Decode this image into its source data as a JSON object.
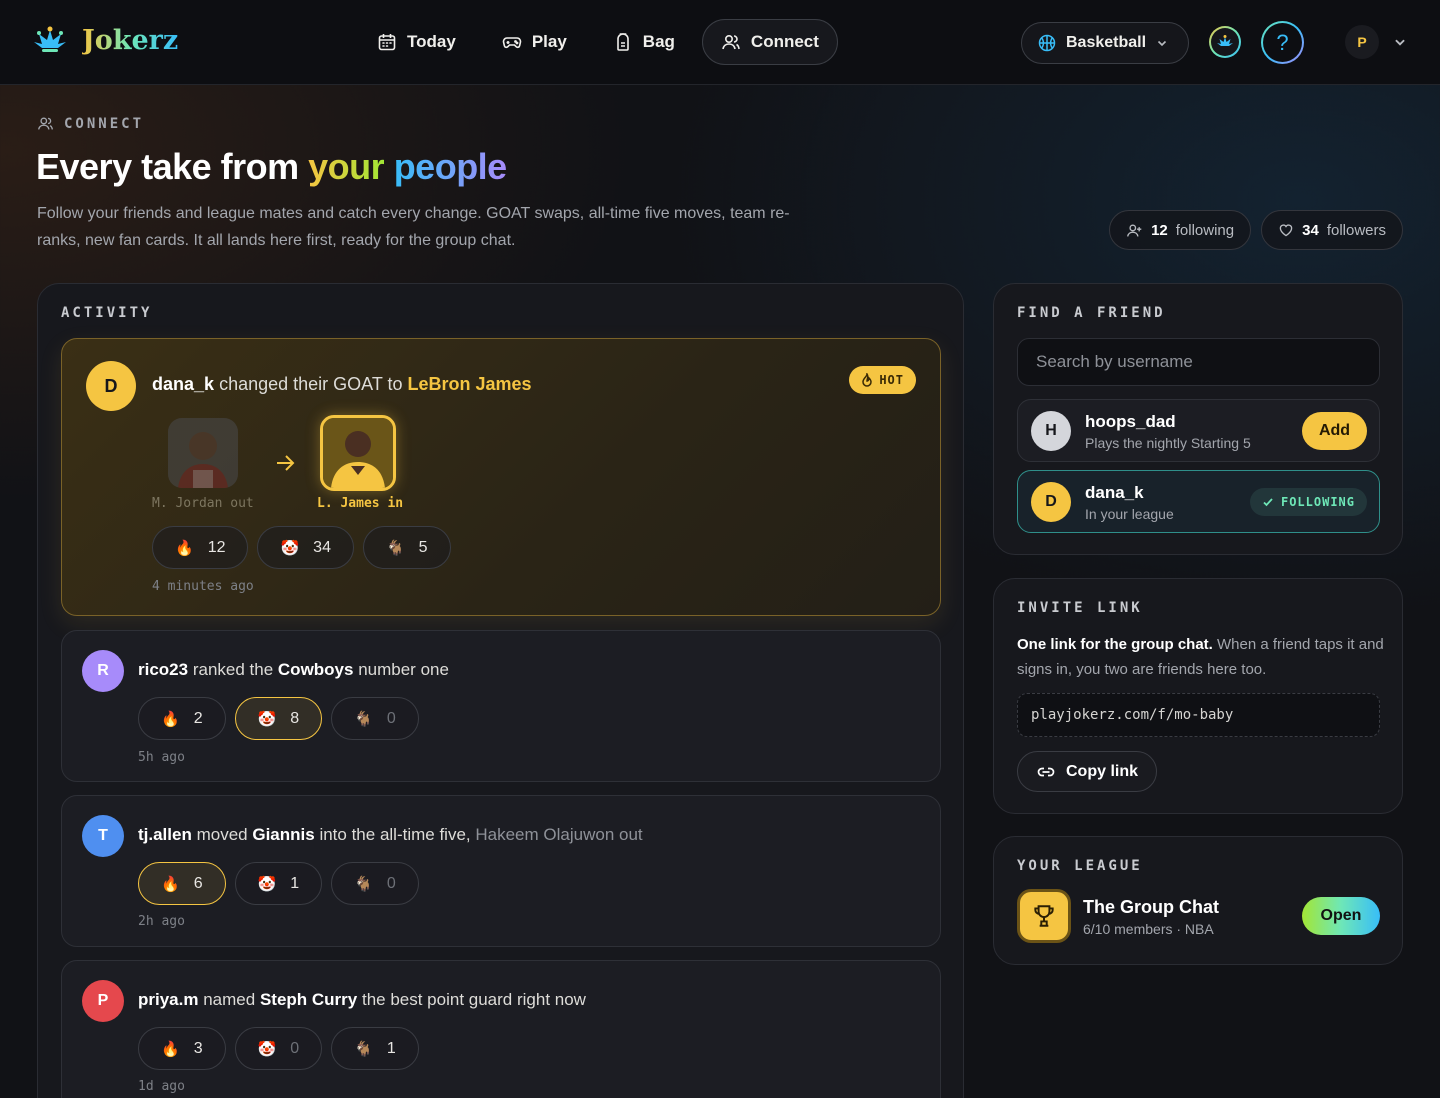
{
  "nav": {
    "brand": "Jokerz",
    "links": [
      {
        "label": "Today",
        "icon": "calendar-icon"
      },
      {
        "label": "Play",
        "icon": "gamepad-icon"
      },
      {
        "label": "Bag",
        "icon": "bag-icon"
      },
      {
        "label": "Connect",
        "icon": "people-icon",
        "active": true
      }
    ],
    "sport": "Basketball",
    "help": "?",
    "user_initial": "P"
  },
  "header": {
    "eyebrow": "CONNECT",
    "title_pre": "Every take from ",
    "title_hl1": "your",
    "title_hl2": "people",
    "subtitle": "Follow your friends and league mates and catch every change. GOAT swaps, all-time five moves, team re-ranks, new fan cards. It all lands here first, ready for the group chat.",
    "following_count": "12",
    "following_label": "following",
    "followers_count": "34",
    "followers_label": "followers"
  },
  "activity": {
    "label": "ACTIVITY",
    "items": [
      {
        "initial": "D",
        "user": "dana_k",
        "text": "changed their GOAT to",
        "target": "LeBron James",
        "hot_label": "HOT",
        "out_label": "M. Jordan out",
        "in_label": "L. James in",
        "fire": "12",
        "clown": "34",
        "goat": "5",
        "ago": "4 minutes ago"
      },
      {
        "initial": "R",
        "user": "rico23",
        "pre": "ranked the",
        "team": "Cowboys",
        "post": "number one",
        "fire": "2",
        "clown": "8",
        "goat": "0",
        "ago": "5h ago"
      },
      {
        "initial": "T",
        "user": "tj.allen",
        "pre": "moved",
        "player": "Giannis",
        "post": "into the all-time five,",
        "muted": "Hakeem Olajuwon out",
        "fire": "6",
        "clown": "1",
        "goat": "0",
        "ago": "2h ago"
      },
      {
        "initial": "P",
        "user": "priya.m",
        "pre": "named",
        "player": "Steph Curry",
        "post": "the best point guard right now",
        "fire": "3",
        "clown": "0",
        "goat": "1",
        "ago": "1d ago"
      }
    ]
  },
  "find": {
    "label": "FIND A FRIEND",
    "placeholder": "Search by username",
    "friends": [
      {
        "initial": "H",
        "name": "hoops_dad",
        "sub": "Plays the nightly Starting 5",
        "action": "Add"
      },
      {
        "initial": "D",
        "name": "dana_k",
        "sub": "In your league",
        "status": "FOLLOWING"
      }
    ]
  },
  "invite": {
    "label": "INVITE LINK",
    "bold": "One link for the group chat.",
    "text": " When a friend taps it and signs in, you two are friends here too.",
    "link": "playjokerz.com/f/mo-baby",
    "copy": "Copy link"
  },
  "league": {
    "label": "YOUR LEAGUE",
    "name": "The Group Chat",
    "sub": "6/10 members · NBA",
    "open": "Open"
  },
  "colors": {
    "accent": "#f5c542",
    "teal": "#6ee7b7",
    "sky": "#38bdf8",
    "bg": "#111216"
  }
}
